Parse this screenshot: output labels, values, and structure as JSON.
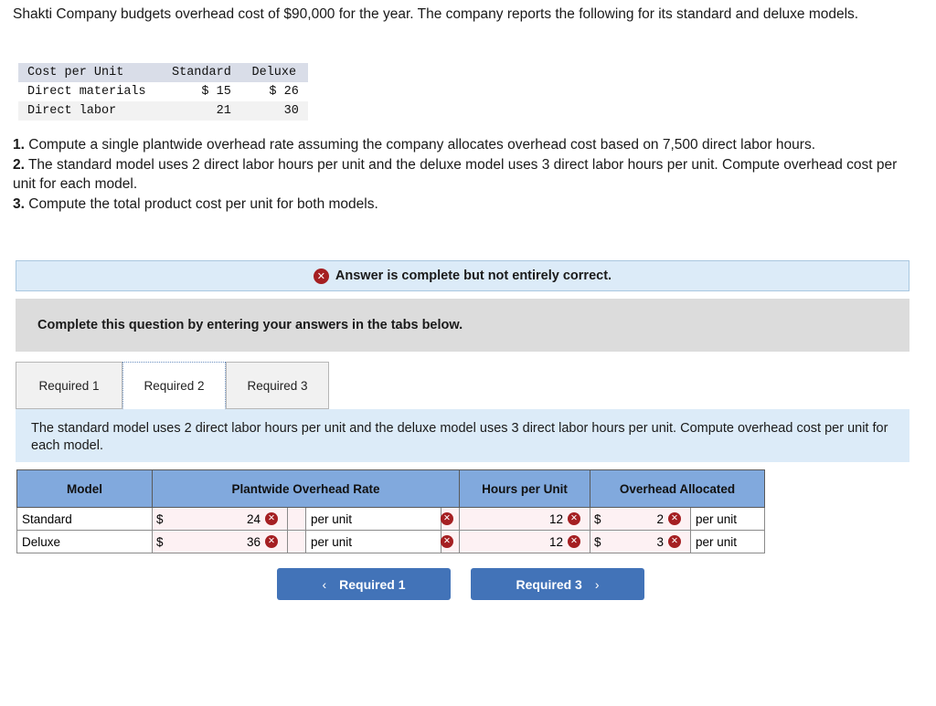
{
  "intro": "Shakti Company budgets overhead cost of $90,000 for the year. The company reports the following for its standard and deluxe models.",
  "cost_table": {
    "headers": [
      "Cost per Unit",
      "Standard",
      "Deluxe"
    ],
    "rows": [
      {
        "label": "Direct materials",
        "standard": "$ 15",
        "deluxe": "$ 26"
      },
      {
        "label": "Direct labor",
        "standard": "21",
        "deluxe": "30"
      }
    ]
  },
  "requirements": [
    {
      "num": "1.",
      "text": " Compute a single plantwide overhead rate assuming the company allocates overhead cost based on 7,500 direct labor hours."
    },
    {
      "num": "2.",
      "text": " The standard model uses 2 direct labor hours per unit and the deluxe model uses 3 direct labor hours per unit. Compute overhead cost per unit for each model."
    },
    {
      "num": "3.",
      "text": " Compute the total product cost per unit for both models."
    }
  ],
  "status": {
    "icon": "error-x-icon",
    "message": "Answer is complete but not entirely correct.",
    "background": "#dcebf8",
    "icon_color": "#a51f22"
  },
  "instruction_bar": {
    "text": "Complete this question by entering your answers in the tabs below."
  },
  "tabs": [
    {
      "label": "Required 1",
      "active": false
    },
    {
      "label": "Required 2",
      "active": true
    },
    {
      "label": "Required 3",
      "active": false
    }
  ],
  "tab_panel": {
    "text": "The standard model uses 2 direct labor hours per unit and the deluxe model uses 3 direct labor hours per unit. Compute overhead cost per unit for each model."
  },
  "answer_grid": {
    "headers": [
      "Model",
      "Plantwide Overhead Rate",
      "Hours per Unit",
      "Overhead Allocated"
    ],
    "header_color": "#81a9dd",
    "input_background": "#fdf1f3",
    "rows": [
      {
        "model": "Standard",
        "rate_symbol": "$",
        "rate_value": "24",
        "rate_mark": "incorrect",
        "rate_unit": "per unit",
        "rate_unit_mark": "incorrect",
        "hours_value": "12",
        "hours_mark": "incorrect",
        "alloc_symbol": "$",
        "alloc_value": "2",
        "alloc_mark": "incorrect",
        "alloc_unit": "per unit"
      },
      {
        "model": "Deluxe",
        "rate_symbol": "$",
        "rate_value": "36",
        "rate_mark": "incorrect",
        "rate_unit": "per unit",
        "rate_unit_mark": "incorrect",
        "hours_value": "12",
        "hours_mark": "incorrect",
        "alloc_symbol": "$",
        "alloc_value": "3",
        "alloc_mark": "incorrect",
        "alloc_unit": "per unit"
      }
    ]
  },
  "nav": {
    "prev_label": "Required 1",
    "prev_chevron": "‹",
    "next_label": "Required 3",
    "next_chevron": "›",
    "button_color": "#4273b8"
  },
  "glyphs": {
    "x": "✕"
  }
}
